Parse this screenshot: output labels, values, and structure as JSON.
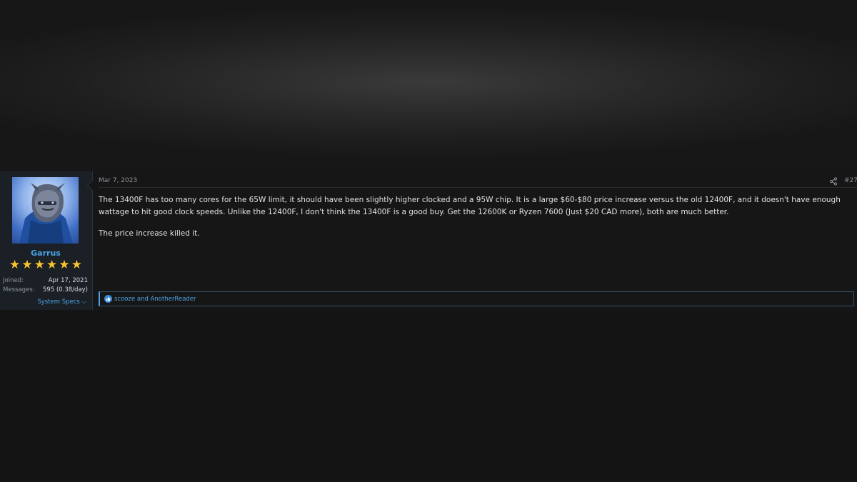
{
  "post": {
    "date": "Mar 7, 2023",
    "number": "#27",
    "paragraphs": [
      "The 13400F has too many cores for the 65W limit, it should have been slightly higher clocked and a 95W chip. It is a large $60-$80 price increase versus the old 12400F, and it doesn't have enough wattage to hit good clock speeds. Unlike the 12400F, I don't think the 13400F is a good buy. Get the 12600K or Ryzen 7600 (Just $20 CAD more), both are much better.",
      "The price increase killed it."
    ],
    "reactions": "scooze and AnotherReader"
  },
  "user": {
    "name": "Garrus",
    "stars": [
      "★",
      "★",
      "★",
      "★",
      "★",
      "★"
    ],
    "joined_label": "Joined:",
    "joined_value": "Apr 17, 2021",
    "messages_label": "Messages:",
    "messages_value": "595 (0.38/day)",
    "system_specs": "System Specs ⌵"
  },
  "colors": {
    "accent": "#4aa3e6",
    "star": "#f5c531",
    "background": "#141414"
  },
  "icons": {
    "share": "share-icon",
    "like": "thumbs-up-icon"
  }
}
